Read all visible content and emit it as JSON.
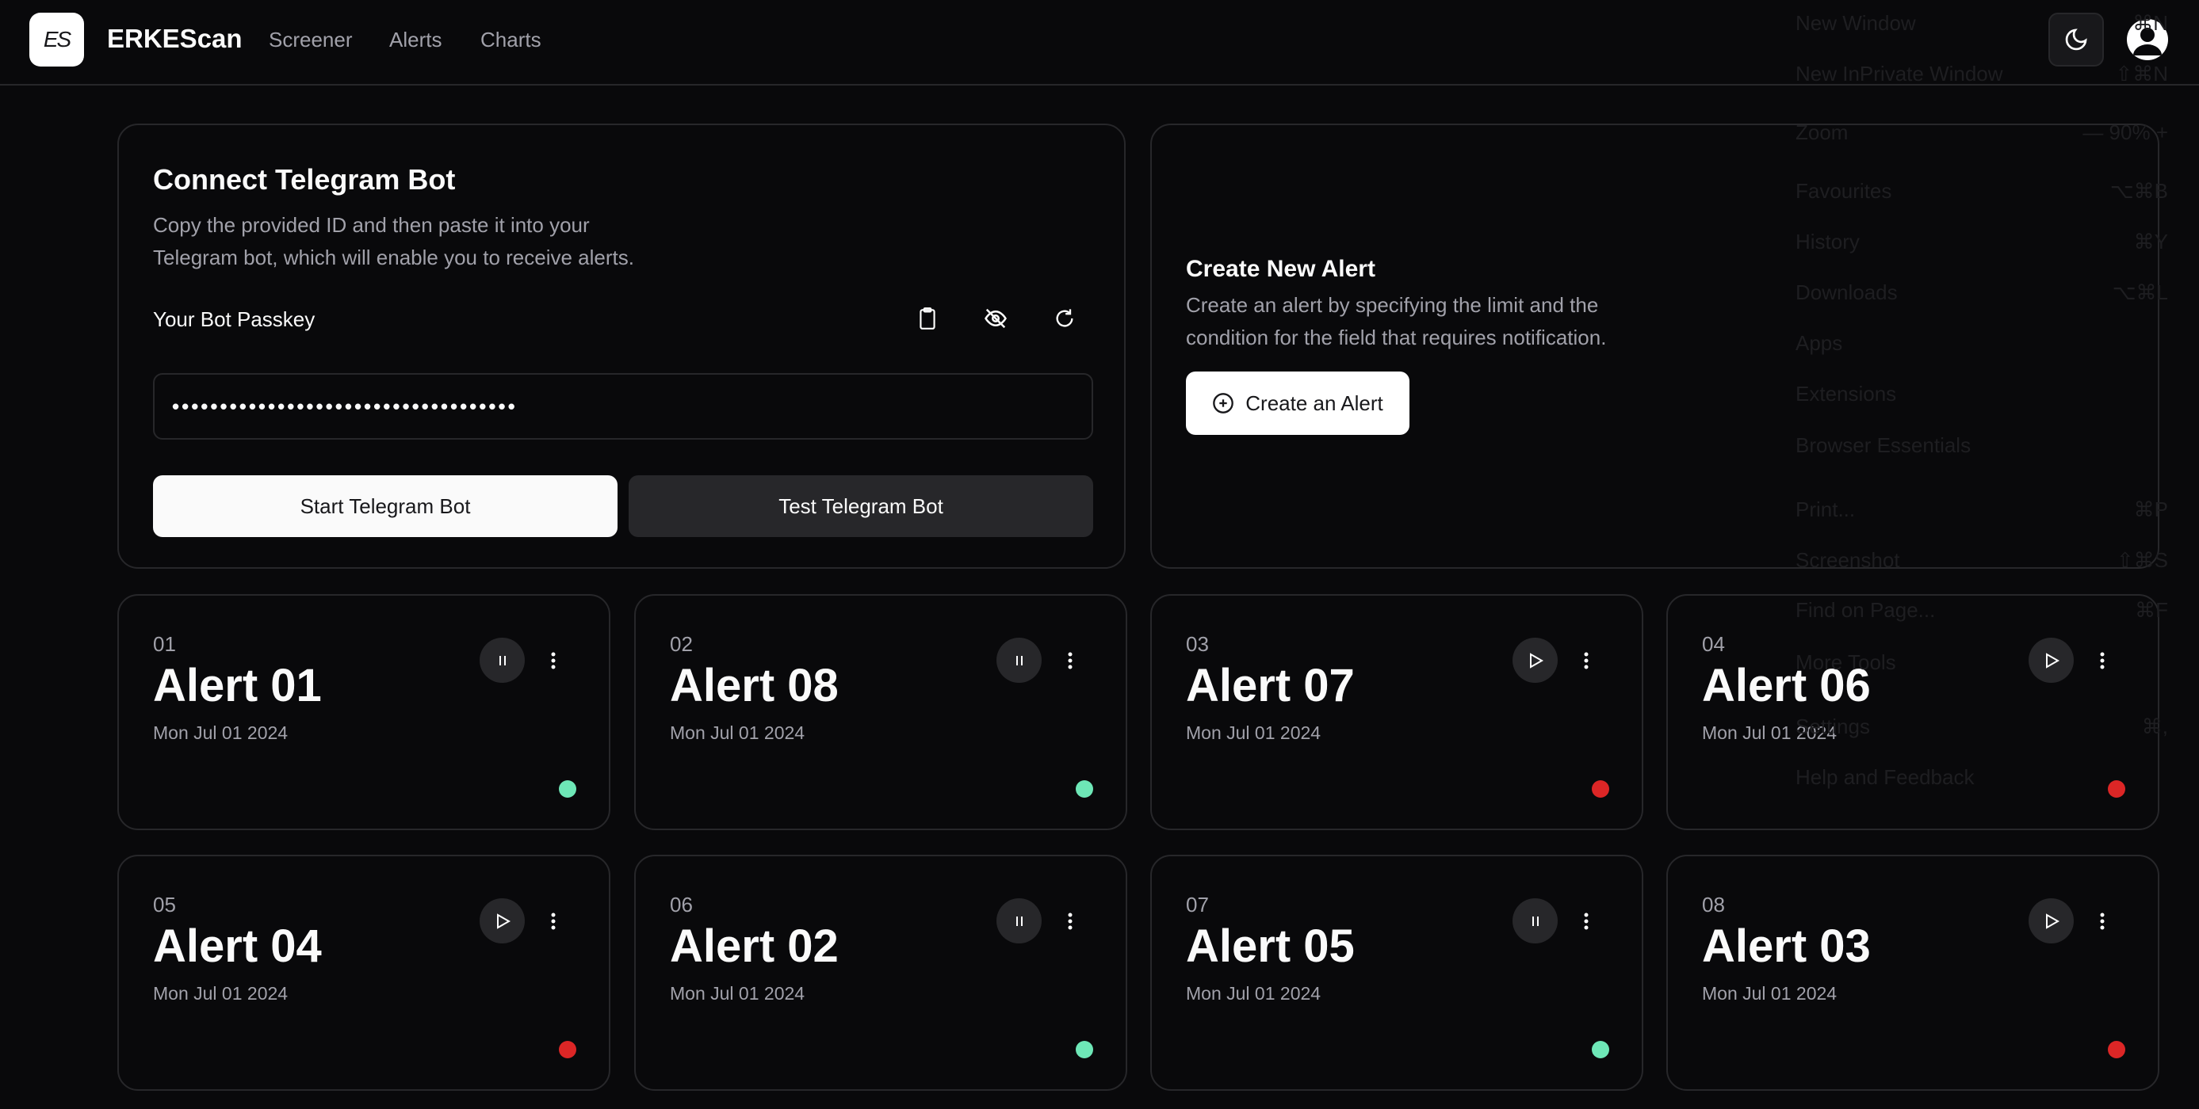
{
  "header": {
    "logo_text": "ES",
    "brand": "ERKEScan",
    "nav": [
      "Screener",
      "Alerts",
      "Charts"
    ],
    "theme_icon": "moon-icon",
    "avatar_icon": "user-icon"
  },
  "telegram": {
    "title": "Connect Telegram Bot",
    "desc_line1": "Copy the provided ID and then paste it into your",
    "desc_line2": "Telegram bot, which will enable you to receive alerts.",
    "passkey_label": "Your Bot Passkey",
    "passkey_value": "••••••••••••••••••••••••••••••••••••",
    "icons": [
      "clipboard-icon",
      "eye-off-icon",
      "refresh-icon"
    ],
    "start_label": "Start Telegram Bot",
    "test_label": "Test Telegram Bot"
  },
  "create": {
    "title": "Create New Alert",
    "desc_line1": "Create an alert by specifying the limit and the",
    "desc_line2": "condition for the field that requires notification.",
    "button_label": "Create an Alert"
  },
  "colors": {
    "active": "#6ee7b7",
    "inactive": "#dc2626"
  },
  "alerts": [
    {
      "num": "01",
      "title": "Alert 01",
      "date": "Mon Jul 01 2024",
      "state": "pause",
      "status": "active"
    },
    {
      "num": "02",
      "title": "Alert 08",
      "date": "Mon Jul 01 2024",
      "state": "pause",
      "status": "active"
    },
    {
      "num": "03",
      "title": "Alert 07",
      "date": "Mon Jul 01 2024",
      "state": "play",
      "status": "inactive"
    },
    {
      "num": "04",
      "title": "Alert 06",
      "date": "Mon Jul 01 2024",
      "state": "play",
      "status": "inactive"
    },
    {
      "num": "05",
      "title": "Alert 04",
      "date": "Mon Jul 01 2024",
      "state": "play",
      "status": "inactive"
    },
    {
      "num": "06",
      "title": "Alert 02",
      "date": "Mon Jul 01 2024",
      "state": "pause",
      "status": "active"
    },
    {
      "num": "07",
      "title": "Alert 05",
      "date": "Mon Jul 01 2024",
      "state": "pause",
      "status": "active"
    },
    {
      "num": "08",
      "title": "Alert 03",
      "date": "Mon Jul 01 2024",
      "state": "play",
      "status": "inactive"
    }
  ],
  "browser_menu": [
    {
      "label": "New Window",
      "shortcut": "⌘N"
    },
    {
      "label": "New InPrivate Window",
      "shortcut": "⇧⌘N"
    },
    {
      "label": "Zoom",
      "shortcut": "—  90%  +"
    },
    {
      "label": "Favourites",
      "shortcut": "⌥⌘B"
    },
    {
      "label": "History",
      "shortcut": "⌘Y"
    },
    {
      "label": "Downloads",
      "shortcut": "⌥⌘L"
    },
    {
      "label": "Apps",
      "shortcut": ""
    },
    {
      "label": "Extensions",
      "shortcut": ""
    },
    {
      "label": "Browser Essentials",
      "shortcut": ""
    },
    {
      "label": "Print...",
      "shortcut": "⌘P"
    },
    {
      "label": "Screenshot",
      "shortcut": "⇧⌘S"
    },
    {
      "label": "Find on Page...",
      "shortcut": "⌘F"
    },
    {
      "label": "More Tools",
      "shortcut": ""
    },
    {
      "label": "Settings",
      "shortcut": "⌘,"
    },
    {
      "label": "Help and Feedback",
      "shortcut": ""
    }
  ]
}
